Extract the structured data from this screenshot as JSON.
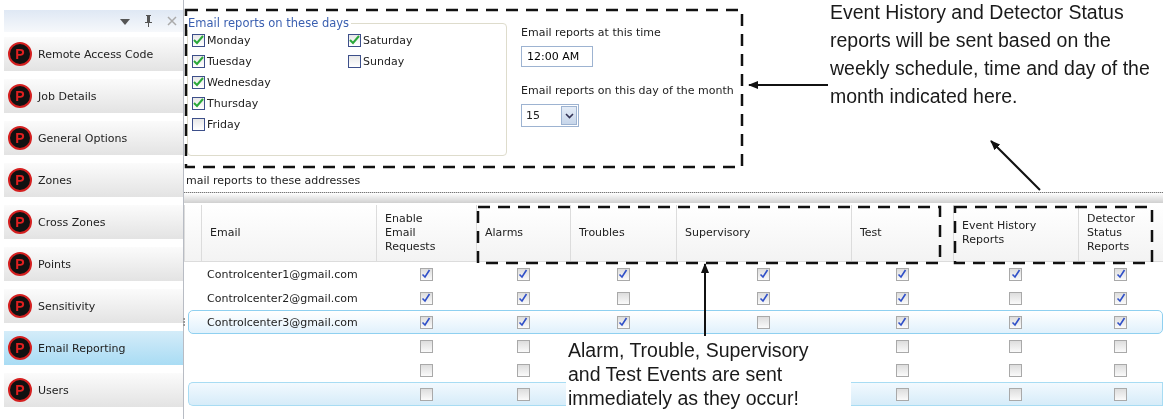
{
  "sidebar": {
    "items": [
      {
        "icon": "P",
        "label": "Remote Access Code",
        "selected": false
      },
      {
        "icon": "P",
        "label": "Job Details",
        "selected": false
      },
      {
        "icon": "P",
        "label": "General Options",
        "selected": false
      },
      {
        "icon": "P",
        "label": "Zones",
        "selected": false
      },
      {
        "icon": "P",
        "label": "Cross Zones",
        "selected": false
      },
      {
        "icon": "P",
        "label": "Points",
        "selected": false
      },
      {
        "icon": "P",
        "label": "Sensitivity",
        "selected": false
      },
      {
        "icon": "P",
        "label": "Email Reporting",
        "selected": true
      },
      {
        "icon": "P",
        "label": "Users",
        "selected": false
      }
    ]
  },
  "schedule": {
    "days_title": "Email reports on these days",
    "days": [
      {
        "label": "Monday",
        "checked": true
      },
      {
        "label": "Tuesday",
        "checked": true
      },
      {
        "label": "Wednesday",
        "checked": true
      },
      {
        "label": "Thursday",
        "checked": true
      },
      {
        "label": "Friday",
        "checked": false
      },
      {
        "label": "Saturday",
        "checked": true
      },
      {
        "label": "Sunday",
        "checked": false
      }
    ],
    "time_label": "Email reports at this time",
    "time_value": "12:00 AM",
    "day_label": "Email reports on this day of the month",
    "day_value": "15"
  },
  "addresses_label": "mail reports to these addresses",
  "table": {
    "columns": [
      "Email",
      "Enable Email Requests",
      "Alarms",
      "Troubles",
      "Supervisory",
      "Test",
      "Event History Reports",
      "Detector Status Reports"
    ],
    "rows": [
      {
        "kind": "data",
        "selected": false,
        "email": "Controlcenter1@gmail.com",
        "checks": {
          "enable": true,
          "alarms": true,
          "troubles": true,
          "supervisory": true,
          "test": true,
          "event_history": true,
          "detector_status": true
        }
      },
      {
        "kind": "data",
        "selected": false,
        "email": "Controlcenter2@gmail.com",
        "checks": {
          "enable": true,
          "alarms": true,
          "troubles": false,
          "supervisory": true,
          "test": true,
          "event_history": false,
          "detector_status": true
        }
      },
      {
        "kind": "data",
        "selected": true,
        "email": "Controlcenter3@gmail.com",
        "checks": {
          "enable": true,
          "alarms": true,
          "troubles": true,
          "supervisory": false,
          "test": true,
          "event_history": true,
          "detector_status": true
        }
      },
      {
        "kind": "data",
        "selected": false,
        "checks": {
          "enable": false,
          "alarms": false,
          "test": false,
          "event_history": false,
          "detector_status": false
        }
      },
      {
        "kind": "data",
        "selected": false,
        "checks": {
          "enable": false,
          "alarms": false,
          "test": false,
          "event_history": false,
          "detector_status": false
        }
      },
      {
        "kind": "new",
        "selected": false,
        "checks": {
          "enable": false,
          "alarms": false,
          "test": false,
          "event_history": false,
          "detector_status": false
        }
      }
    ]
  },
  "annotations": [
    {
      "text": "Event History and Detector Status reports will be sent based on the weekly schedule, time and day of the month indicated here."
    },
    {
      "text": "Alarm, Trouble, Supervisory and Test Events are sent immediately as they occur!"
    }
  ]
}
